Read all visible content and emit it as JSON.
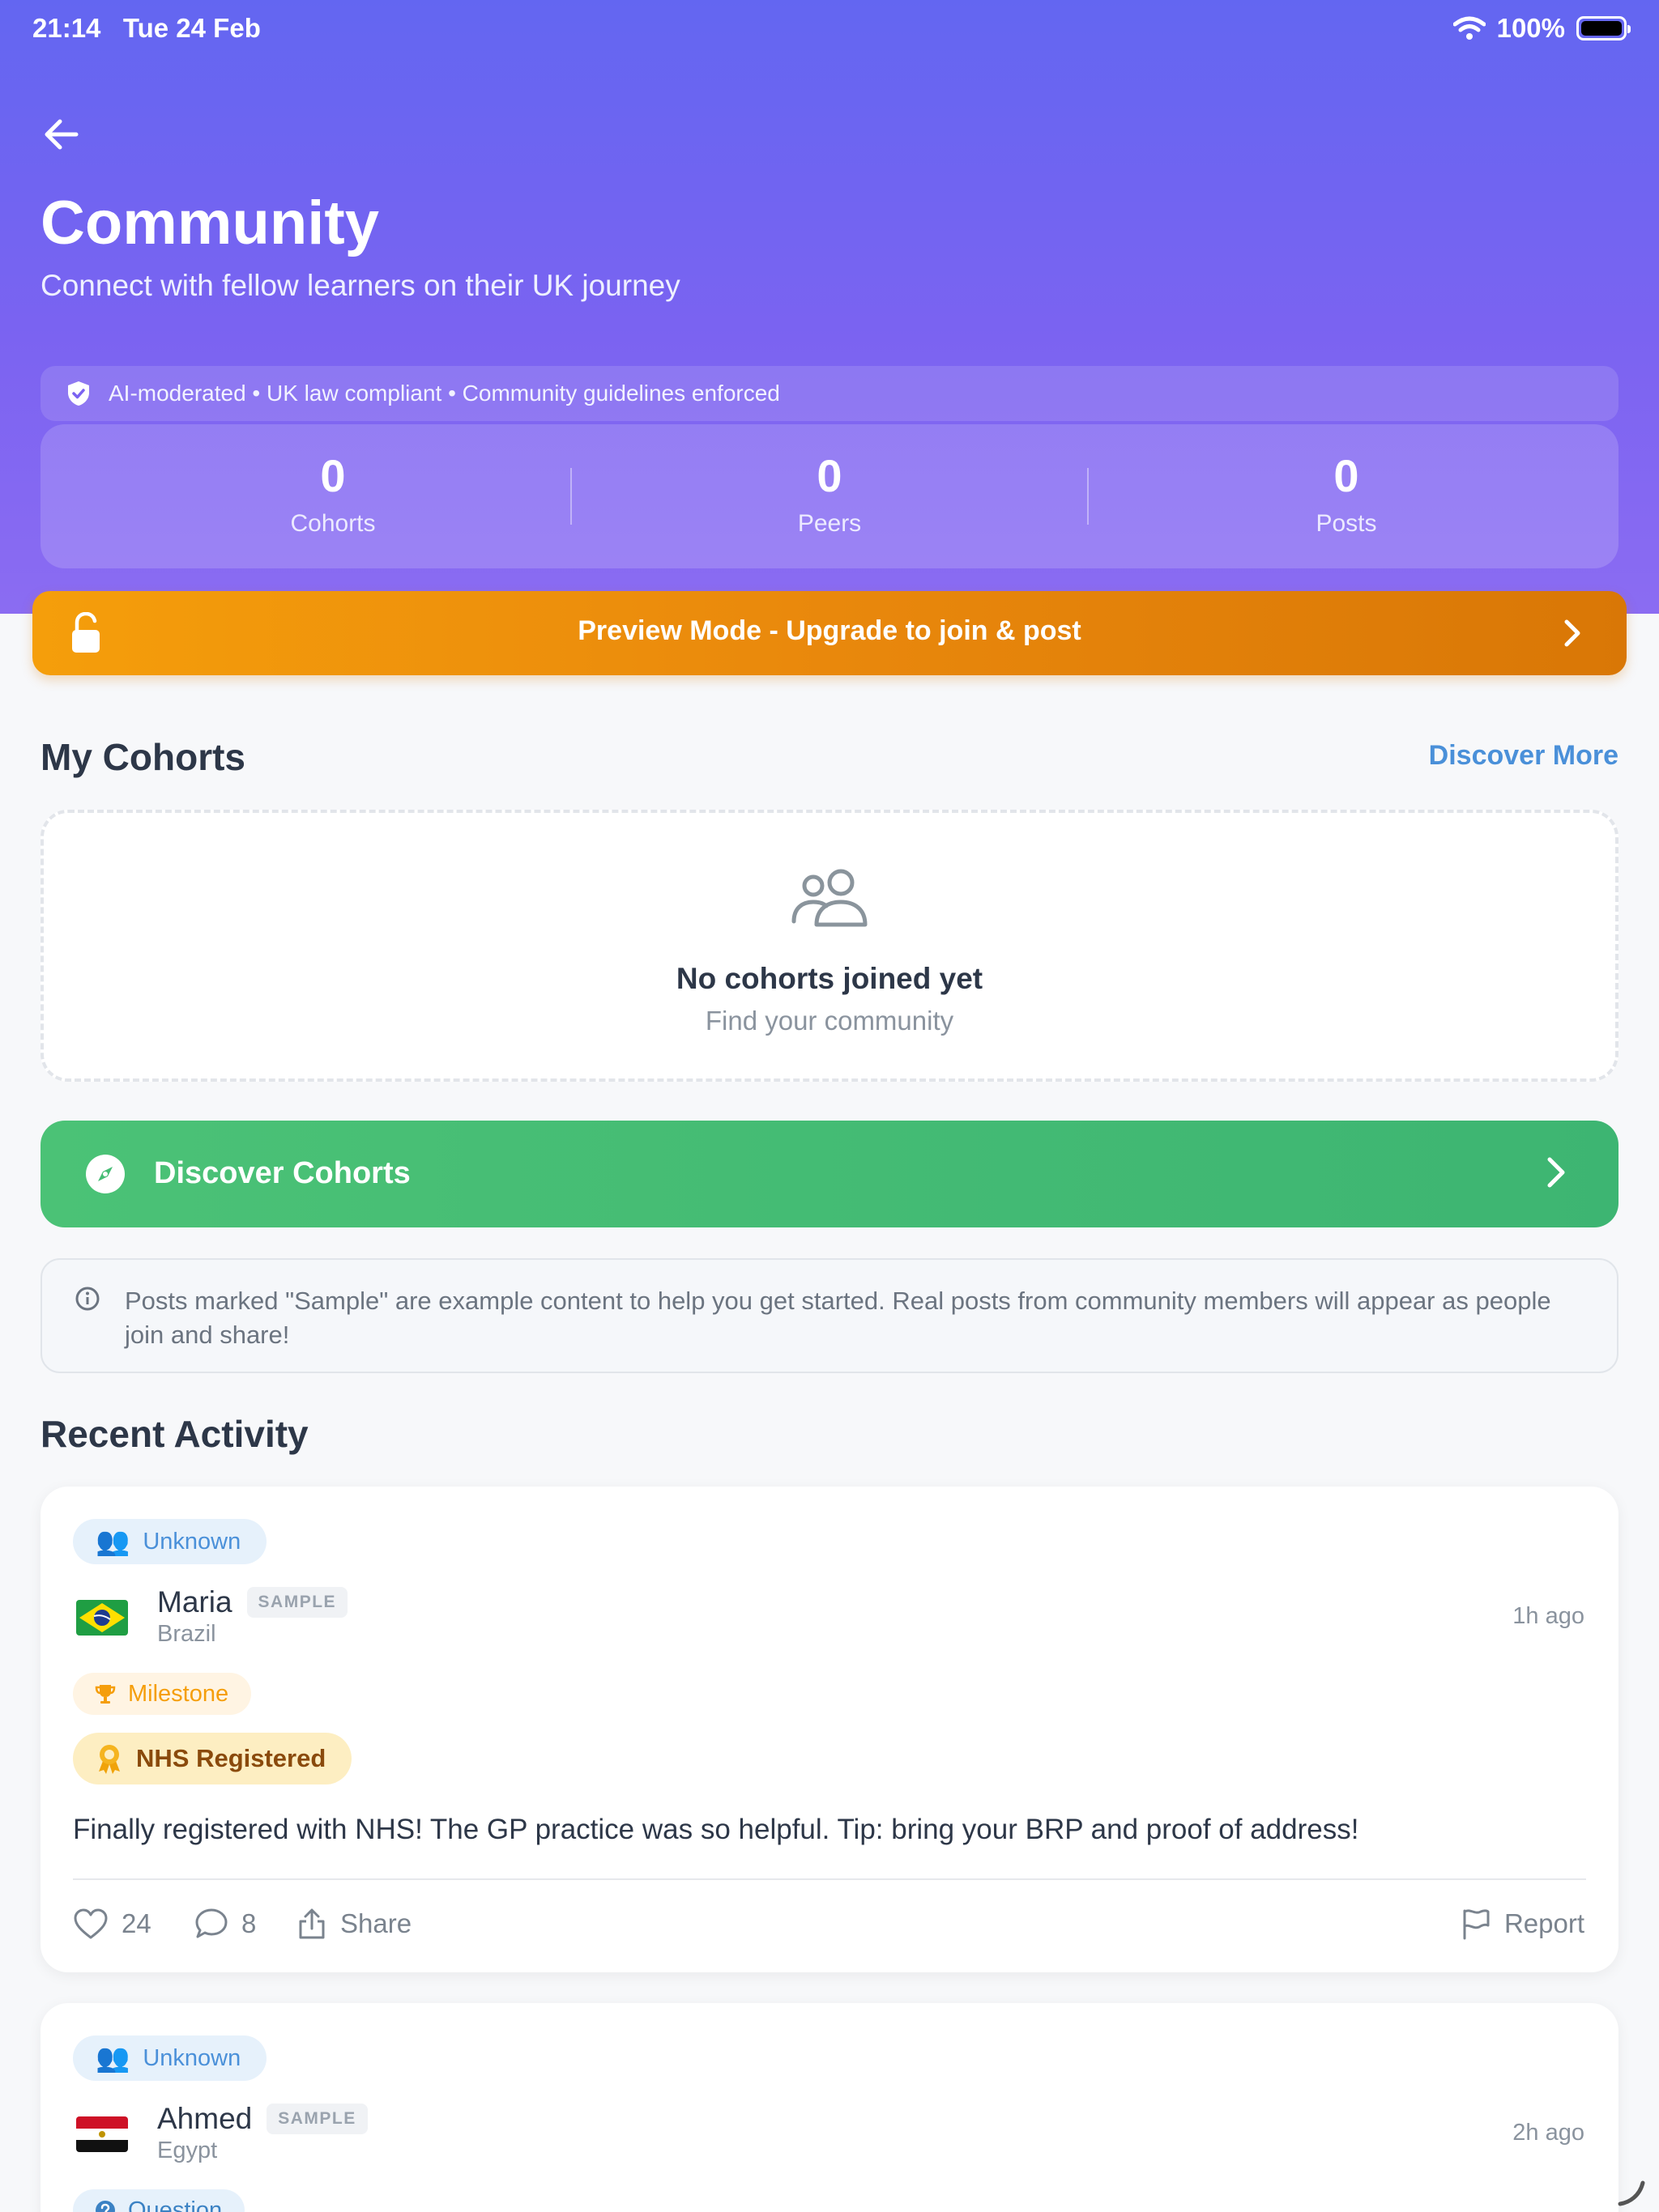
{
  "status_bar": {
    "time": "21:14",
    "date": "Tue 24 Feb",
    "battery": "100%"
  },
  "header": {
    "title": "Community",
    "subtitle": "Connect with fellow learners on their UK journey",
    "moderation_note": "AI-moderated • UK law compliant • Community guidelines enforced"
  },
  "stats": [
    {
      "value": "0",
      "label": "Cohorts"
    },
    {
      "value": "0",
      "label": "Peers"
    },
    {
      "value": "0",
      "label": "Posts"
    }
  ],
  "preview_bar": {
    "label": "Preview Mode - Upgrade to join & post"
  },
  "my_cohorts": {
    "title": "My Cohorts",
    "discover_more": "Discover More",
    "empty_title": "No cohorts joined yet",
    "empty_subtitle": "Find your community"
  },
  "discover_button": {
    "label": "Discover Cohorts"
  },
  "info_note": "Posts marked \"Sample\" are example content to help you get started. Real posts from community members will appear as people join and share!",
  "recent_activity": {
    "title": "Recent Activity",
    "posts": [
      {
        "cohort": "Unknown",
        "author": "Maria",
        "badge": "SAMPLE",
        "country": "Brazil",
        "time": "1h ago",
        "type": "Milestone",
        "achievement": "NHS Registered",
        "body": "Finally registered with NHS! The GP practice was so helpful. Tip: bring your BRP and proof of address!",
        "likes": "24",
        "comments": "8",
        "share": "Share",
        "report": "Report"
      },
      {
        "cohort": "Unknown",
        "author": "Ahmed",
        "badge": "SAMPLE",
        "country": "Egypt",
        "time": "2h ago",
        "type": "Question"
      }
    ]
  },
  "colors": {
    "hero_start": "#6366f1",
    "hero_end": "#8b6cf2",
    "preview_amber": "#f59e0b",
    "discover_green": "#48bb78",
    "link_blue": "#4a90d9"
  },
  "icons": {
    "back": "arrow-left-icon",
    "shield": "shield-check-icon",
    "lock": "unlock-icon",
    "people": "people-icon",
    "compass": "compass-icon",
    "info": "info-icon",
    "trophy": "trophy-icon",
    "award": "award-icon",
    "heart": "heart-icon",
    "comment": "comment-icon",
    "share": "share-icon",
    "flag": "flag-icon"
  }
}
